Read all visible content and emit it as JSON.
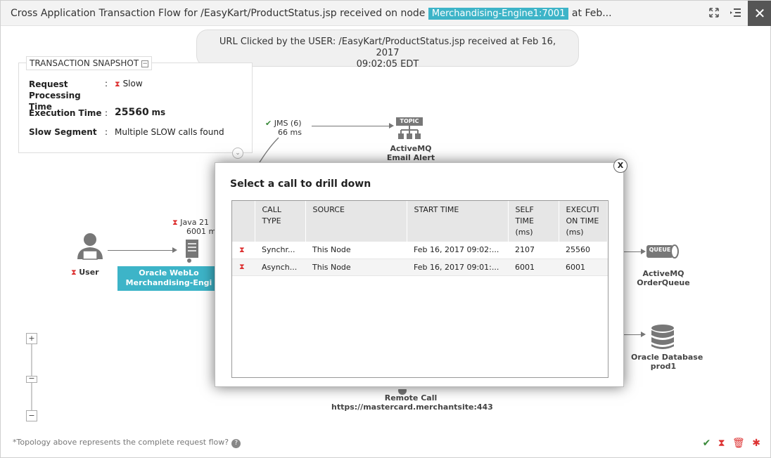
{
  "header": {
    "title_prefix": "Cross Application Transaction Flow for /EasyKart/ProductStatus.jsp received on node",
    "node": "Merchandising-Engine1:7001",
    "title_suffix": "at Feb..."
  },
  "url_box": {
    "line1": "URL Clicked by the USER: /EasyKart/ProductStatus.jsp received at Feb 16, 2017",
    "line2": "09:02:05 EDT"
  },
  "snapshot": {
    "title": "TRANSACTION SNAPSHOT",
    "rows": [
      {
        "label": "Request Processing Time",
        "value": "Slow"
      },
      {
        "label": "Execution Time",
        "value": "25560",
        "unit": "ms"
      },
      {
        "label": "Slow Segment",
        "value": "Multiple SLOW calls found"
      }
    ]
  },
  "topology": {
    "jms_label": "JMS (6)",
    "jms_time": "66 ms",
    "topic_badge": "TOPIC",
    "topic_name1": "ActiveMQ",
    "topic_name2": "Email Alert",
    "java_label": "Java 21",
    "java_time": "6001 m",
    "user_label": "User",
    "app_line1": "Oracle WebLo",
    "app_line2": "Merchandising-Engi",
    "queue_badge": "QUEUE",
    "queue_name1": "ActiveMQ",
    "queue_name2": "OrderQueue",
    "db_name1": "Oracle Database",
    "db_name2": "prod1",
    "remote_name1": "Remote Call",
    "remote_name2": "https://mastercard.merchantsite:443"
  },
  "footer": {
    "note": "*Topology above represents the complete request flow?"
  },
  "modal": {
    "title": "Select a call to drill down",
    "columns": [
      "CALL TYPE",
      "SOURCE",
      "START TIME",
      "SELF TIME (ms)",
      "EXECUTI ON TIME (ms)"
    ],
    "rows": [
      {
        "call_type": "Synchr...",
        "source": "This Node",
        "start_time": "Feb 16, 2017 09:02:...",
        "self_time": "2107",
        "execution_time": "25560"
      },
      {
        "call_type": "Asynch...",
        "source": "This Node",
        "start_time": "Feb 16, 2017 09:01:...",
        "self_time": "6001",
        "execution_time": "6001"
      }
    ]
  },
  "colors": {
    "accent": "#3db4c8",
    "slow": "#d33333",
    "ok": "#3a8a3a"
  }
}
